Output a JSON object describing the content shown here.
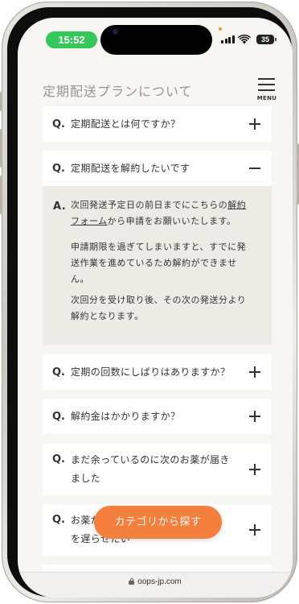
{
  "status_bar": {
    "time": "15:52",
    "battery": "35"
  },
  "header": {
    "title": "定期配送プランについて",
    "menu_label": "MENU"
  },
  "faq": {
    "q_mark": "Q.",
    "a_mark": "A.",
    "items": [
      {
        "question": "定期配送とは何ですか？",
        "state": "collapsed"
      },
      {
        "question": "定期配送を解約したいです",
        "state": "expanded"
      },
      {
        "question": "定期の回数にしばりはありますか？",
        "state": "collapsed"
      },
      {
        "question": "解約金はかかりますか？",
        "state": "collapsed"
      },
      {
        "question_line1": "まだ余っているのに次のお薬が届き",
        "question_line2": "ました",
        "state": "collapsed"
      },
      {
        "question_line1": "お薬がなくなるまで次回の配送",
        "question_line2": "を遅らせたい",
        "state": "collapsed"
      }
    ],
    "answer": {
      "p1_line1_pre": "次回発送予定日の前日までにこちらの",
      "p1_link_part1": "解約",
      "p1_link_part2": "フォーム",
      "p1_line2_post": "から申請をお願いいたします。",
      "p2_line1": "申請期限を過ぎてしまいますと、すでに発",
      "p2_line2": "送作業を進めているため解約ができませ",
      "p2_line3": "ん。",
      "p3_line1": "次回分を受け取り後、その次の発送分より",
      "p3_line2": "解約となります。"
    }
  },
  "cta": {
    "label": "カテゴリから探す"
  },
  "browser": {
    "url": "oops-jp.com"
  },
  "colors": {
    "accent": "#f57f3d",
    "status_time_bg": "#34c759",
    "page_bg": "#f8f6f2",
    "answer_bg": "#eeebe6"
  }
}
